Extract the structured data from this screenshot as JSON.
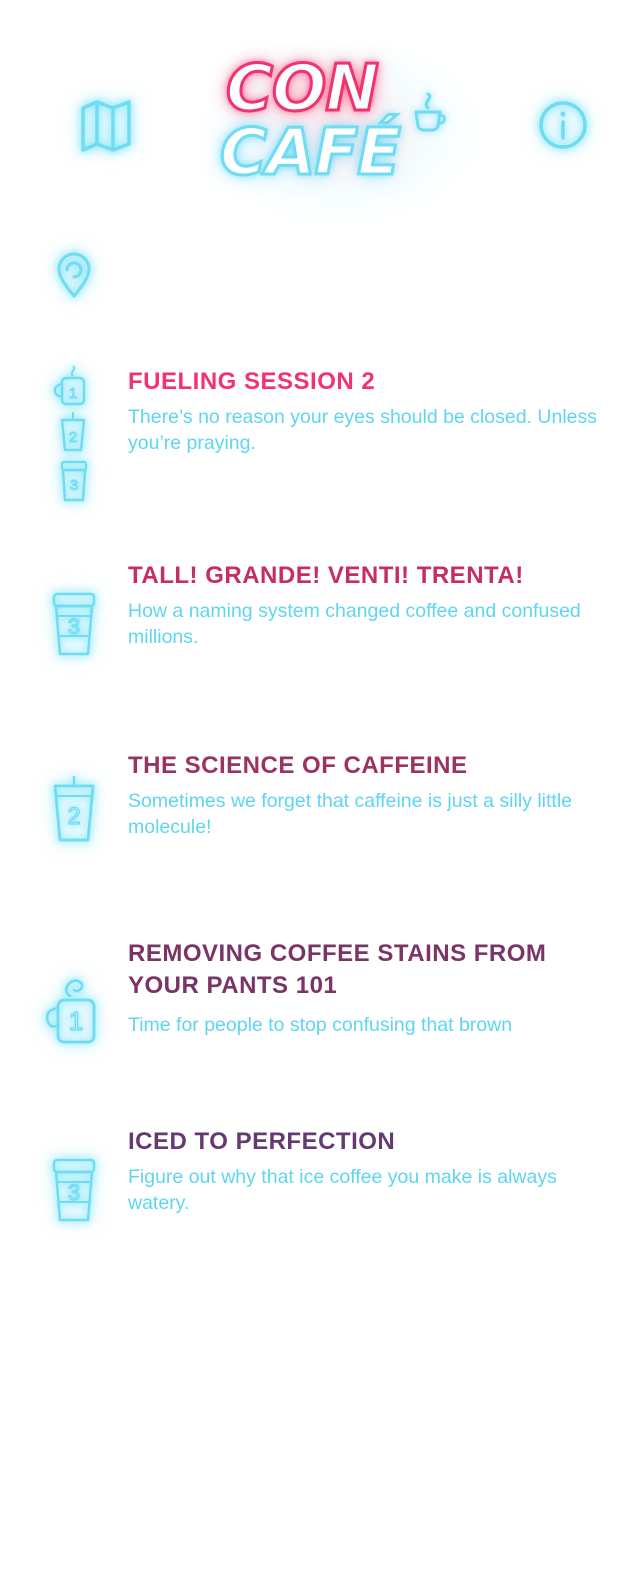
{
  "header": {
    "logo_line1": "CON",
    "logo_line2": "CAFÉ"
  },
  "colors": {
    "neon_pink": "#f0326e",
    "neon_cyan": "#6fdcf2",
    "description_text": "#5fd5ef"
  },
  "icons": {
    "map": "map-icon",
    "info": "info-icon",
    "location": "location-pin-icon"
  },
  "sessions": [
    {
      "title": "FUELING SESSION 2",
      "description": "There’s no reason your eyes should be closed. Unless you’re praying.",
      "title_color": "#f0346f",
      "icon": "cup-stack-icon",
      "icon_numbers": [
        "1",
        "2",
        "3"
      ]
    },
    {
      "title": "TALL! GRANDE! VENTI! TRENTA!",
      "description": "How a naming system changed coffee and confused millions.",
      "title_color": "#c42e63",
      "icon": "takeaway-cup-icon",
      "icon_number": "3"
    },
    {
      "title": "THE SCIENCE OF CAFFEINE",
      "description": "Sometimes we forget that caffeine is just a silly little molecule!",
      "title_color": "#9a3361",
      "icon": "iced-cup-icon",
      "icon_number": "2"
    },
    {
      "title": "REMOVING COFFEE STAINS FROM YOUR PANTS 101",
      "description": "Time for people to stop confusing that brown",
      "title_color": "#7b3466",
      "icon": "mug-icon",
      "icon_number": "1"
    },
    {
      "title": "ICED TO PERFECTION",
      "description": "Figure out why that ice coffee you make is always watery.",
      "title_color": "#653a72",
      "icon": "takeaway-cup-icon",
      "icon_number": "3"
    }
  ]
}
